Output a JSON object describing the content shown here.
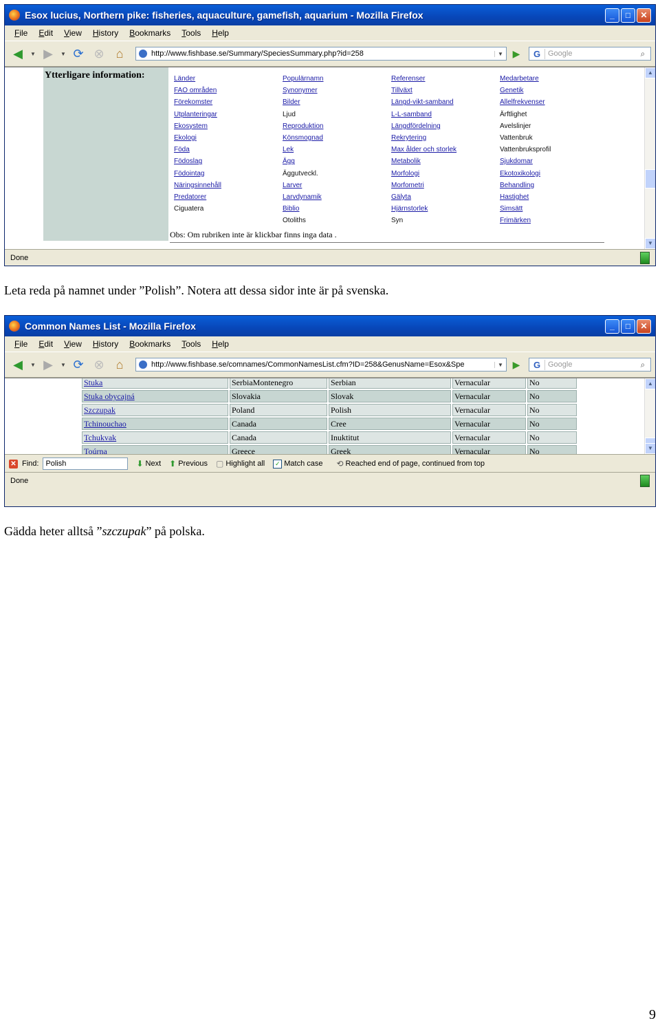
{
  "window1": {
    "title": "Esox lucius, Northern pike: fisheries, aquaculture, gamefish, aquarium - Mozilla Firefox",
    "menu": [
      "File",
      "Edit",
      "View",
      "History",
      "Bookmarks",
      "Tools",
      "Help"
    ],
    "url": "http://www.fishbase.se/Summary/SpeciesSummary.php?id=258",
    "search_placeholder": "Google",
    "heading": "Ytterligare information:",
    "columns": [
      [
        {
          "text": "Länder",
          "link": true
        },
        {
          "text": "FAO områden",
          "link": true
        },
        {
          "text": "Förekomster",
          "link": true
        },
        {
          "text": "Utplanteringar",
          "link": true
        },
        {
          "text": "Ekosystem",
          "link": true
        },
        {
          "text": "Ekologi",
          "link": true
        },
        {
          "text": "Föda",
          "link": true
        },
        {
          "text": "Födoslag",
          "link": true
        },
        {
          "text": "Födointag",
          "link": true
        },
        {
          "text": "Näringsinnehåll",
          "link": true
        },
        {
          "text": "Predatorer",
          "link": true
        },
        {
          "text": "Ciguatera",
          "link": false
        }
      ],
      [
        {
          "text": "Populärnamn",
          "link": true
        },
        {
          "text": "Synonymer",
          "link": true
        },
        {
          "text": "Bilder",
          "link": true
        },
        {
          "text": "Ljud",
          "link": false
        },
        {
          "text": "Reproduktion",
          "link": true
        },
        {
          "text": "Könsmognad",
          "link": true
        },
        {
          "text": "Lek",
          "link": true
        },
        {
          "text": "Ägg",
          "link": true
        },
        {
          "text": "Äggutveckl.",
          "link": false
        },
        {
          "text": "Larver",
          "link": true
        },
        {
          "text": "Larvdynamik",
          "link": true
        },
        {
          "text": "Biblio",
          "link": true
        },
        {
          "text": "Otoliths",
          "link": false
        }
      ],
      [
        {
          "text": "Referenser",
          "link": true
        },
        {
          "text": "Tillväxt",
          "link": true
        },
        {
          "text": "Längd-vikt-samband",
          "link": true
        },
        {
          "text": "L-L-samband",
          "link": true
        },
        {
          "text": "Längdfördelning",
          "link": true
        },
        {
          "text": "Rekrytering",
          "link": true
        },
        {
          "text": "Max ålder och storlek",
          "link": true
        },
        {
          "text": "Metabolik",
          "link": true
        },
        {
          "text": "Morfologi",
          "link": true
        },
        {
          "text": "Morfometri",
          "link": true
        },
        {
          "text": "Gälyta",
          "link": true
        },
        {
          "text": "Hjärnstorlek",
          "link": true
        },
        {
          "text": "Syn",
          "link": false
        }
      ],
      [
        {
          "text": "Medarbetare",
          "link": true
        },
        {
          "text": "Genetik",
          "link": true
        },
        {
          "text": "Allelfrekvenser",
          "link": true
        },
        {
          "text": "Ärftlighet",
          "link": false
        },
        {
          "text": "Avelslinjer",
          "link": false
        },
        {
          "text": "Vattenbruk",
          "link": false
        },
        {
          "text": "Vattenbruksprofil",
          "link": false
        },
        {
          "text": "Sjukdomar",
          "link": true
        },
        {
          "text": "Ekotoxikologi",
          "link": true
        },
        {
          "text": "Behandling",
          "link": true
        },
        {
          "text": "Hastighet",
          "link": true
        },
        {
          "text": "Simsätt",
          "link": true
        },
        {
          "text": "Frimärken",
          "link": true
        }
      ]
    ],
    "note": "Obs: Om rubriken inte är klickbar finns inga data .",
    "status": "Done"
  },
  "caption1": "Leta reda på namnet under ”Polish”. Notera att dessa sidor inte är på svenska.",
  "window2": {
    "title": "Common Names List - Mozilla Firefox",
    "menu": [
      "File",
      "Edit",
      "View",
      "History",
      "Bookmarks",
      "Tools",
      "Help"
    ],
    "url": "http://www.fishbase.se/comnames/CommonNamesList.cfm?ID=258&GenusName=Esox&Spe",
    "search_placeholder": "Google",
    "rows": [
      [
        "Stuka",
        "SerbiaMontenegro",
        "Serbian",
        "Vernacular",
        "No"
      ],
      [
        "Stuka obycajná",
        "Slovakia",
        "Slovak",
        "Vernacular",
        "No"
      ],
      [
        "Szczupak",
        "Poland",
        "Polish",
        "Vernacular",
        "No"
      ],
      [
        "Tchinouchao",
        "Canada",
        "Cree",
        "Vernacular",
        "No"
      ],
      [
        "Tchukvak",
        "Canada",
        "Inuktitut",
        "Vernacular",
        "No"
      ],
      [
        "Toúrna",
        "Greece",
        "Greek",
        "Vernacular",
        "No"
      ]
    ],
    "find": {
      "label": "Find:",
      "value": "Polish",
      "next": "Next",
      "previous": "Previous",
      "highlight": "Highlight all",
      "match_case": "Match case",
      "message": "Reached end of page, continued from top"
    },
    "status": "Done"
  },
  "caption2": {
    "before": "Gädda heter alltså ”",
    "emph": "szczupak",
    "after": "” på polska."
  },
  "page_number": "9"
}
